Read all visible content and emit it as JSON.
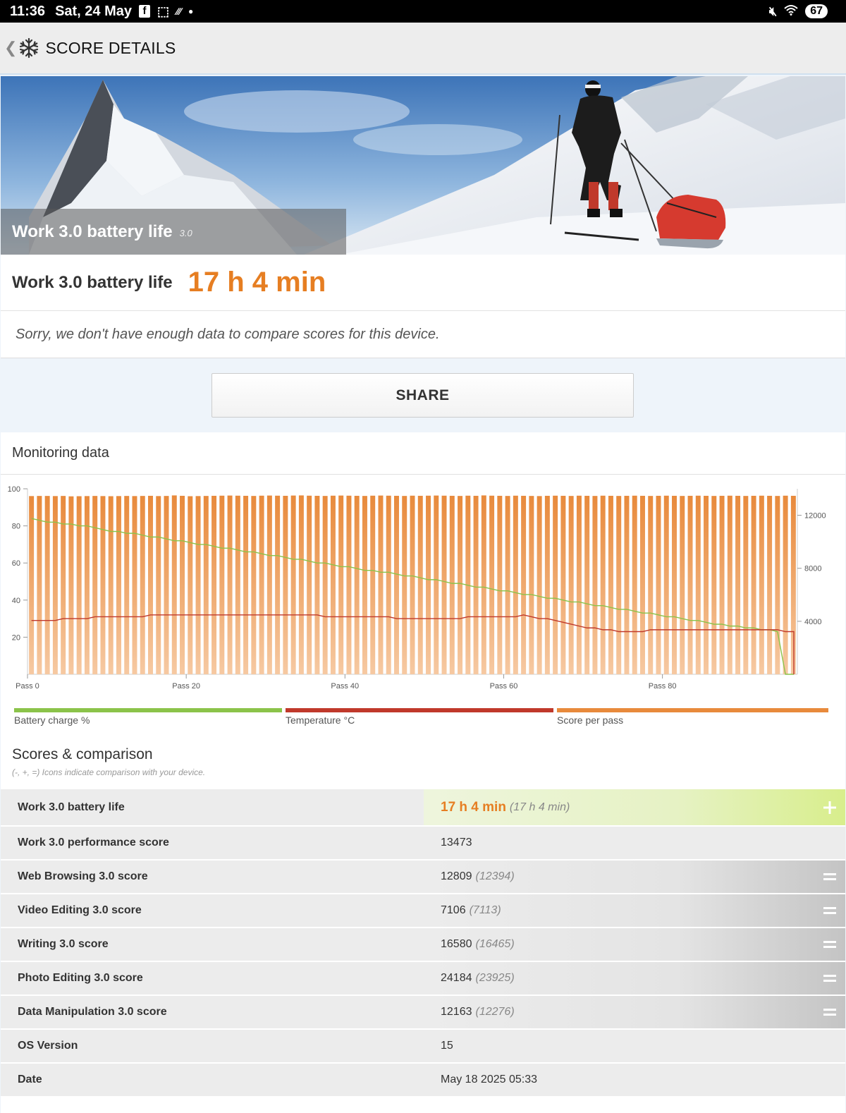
{
  "status_bar": {
    "time": "11:36",
    "date": "Sat, 24 May",
    "battery": "67"
  },
  "header": {
    "title": "SCORE DETAILS"
  },
  "hero": {
    "title": "Work 3.0 battery life",
    "version": "3.0"
  },
  "result": {
    "label": "Work 3.0 battery life",
    "value": "17 h 4 min",
    "note": "Sorry, we don't have enough data to compare scores for this device."
  },
  "share_label": "SHARE",
  "monitoring": {
    "title": "Monitoring data"
  },
  "chart_data": {
    "type": "bar",
    "x_tick_labels": [
      "Pass 0",
      "Pass 20",
      "Pass 40",
      "Pass 60",
      "Pass 80"
    ],
    "x_ticks": [
      0,
      20,
      40,
      60,
      80
    ],
    "xlim": [
      0,
      97
    ],
    "ylim_left": [
      0,
      100
    ],
    "left_ticks": [
      20,
      40,
      60,
      80,
      100
    ],
    "ylim_right": [
      0,
      14000
    ],
    "right_ticks": [
      4000,
      8000,
      12000
    ],
    "legend": [
      "Battery charge %",
      "Temperature °C",
      "Score per pass"
    ],
    "colors": {
      "battery": "#8bc34a",
      "temperature": "#c0392b",
      "score": "#e88a3c"
    },
    "series": [
      {
        "name": "Score per pass",
        "axis": "right",
        "values": [
          13450,
          13460,
          13460,
          13450,
          13460,
          13430,
          13440,
          13450,
          13460,
          13450,
          13440,
          13450,
          13460,
          13450,
          13460,
          13470,
          13450,
          13460,
          13500,
          13470,
          13440,
          13450,
          13460,
          13470,
          13480,
          13490,
          13480,
          13470,
          13460,
          13480,
          13490,
          13480,
          13470,
          13490,
          13500,
          13480,
          13470,
          13460,
          13480,
          13490,
          13480,
          13470,
          13460,
          13480,
          13490,
          13480,
          13470,
          13460,
          13480,
          13470,
          13480,
          13490,
          13480,
          13470,
          13460,
          13480,
          13470,
          13500,
          13480,
          13470,
          13460,
          13480,
          13470,
          13460,
          13450,
          13470,
          13480,
          13470,
          13460,
          13480,
          13470,
          13460,
          13480,
          13470,
          13460,
          13470,
          13480,
          13470,
          13460,
          13470,
          13480,
          13470,
          13460,
          13470,
          13480,
          13470,
          13460,
          13470,
          13480,
          13470,
          13460,
          13470,
          13480,
          13470,
          13460,
          13480,
          13470,
          13490
        ]
      },
      {
        "name": "Battery charge %",
        "axis": "left",
        "values": [
          84,
          83,
          82,
          82,
          81,
          81,
          80,
          80,
          79,
          78,
          77,
          77,
          76,
          76,
          75,
          74,
          74,
          73,
          72,
          72,
          71,
          70,
          70,
          69,
          68,
          68,
          67,
          66,
          66,
          65,
          64,
          64,
          63,
          62,
          62,
          61,
          60,
          60,
          59,
          58,
          58,
          57,
          56,
          56,
          55,
          55,
          54,
          53,
          53,
          52,
          51,
          51,
          50,
          49,
          49,
          48,
          47,
          47,
          46,
          45,
          45,
          44,
          43,
          43,
          42,
          41,
          41,
          40,
          39,
          39,
          38,
          37,
          37,
          36,
          35,
          35,
          34,
          33,
          33,
          32,
          31,
          31,
          30,
          29,
          29,
          28,
          27,
          27,
          26,
          26,
          25,
          25,
          24,
          24,
          23,
          0,
          0,
          0,
          0,
          0
        ]
      },
      {
        "name": "Temperature °C",
        "axis": "left",
        "values": [
          29,
          29,
          29,
          29,
          30,
          30,
          30,
          30,
          31,
          31,
          31,
          31,
          31,
          31,
          31,
          32,
          32,
          32,
          32,
          32,
          32,
          32,
          32,
          32,
          32,
          32,
          32,
          32,
          32,
          32,
          32,
          32,
          32,
          32,
          32,
          32,
          32,
          31,
          31,
          31,
          31,
          31,
          31,
          31,
          31,
          31,
          30,
          30,
          30,
          30,
          30,
          30,
          30,
          30,
          30,
          31,
          31,
          31,
          31,
          31,
          31,
          31,
          32,
          31,
          30,
          30,
          29,
          28,
          27,
          26,
          25,
          25,
          24,
          24,
          23,
          23,
          23,
          23,
          24,
          24,
          24,
          24,
          24,
          24,
          24,
          24,
          24,
          24,
          24,
          24,
          24,
          24,
          24,
          24,
          24,
          23,
          23,
          23,
          23,
          23,
          0,
          0,
          0,
          0,
          0
        ]
      }
    ]
  },
  "scores": {
    "title": "Scores & comparison",
    "note": "(-, +, =) Icons indicate comparison with your device.",
    "rows": [
      {
        "label": "Work 3.0 battery life",
        "value": "17 h 4 min",
        "ref": "(17 h 4 min)",
        "icon": "plus-icon"
      },
      {
        "label": "Work 3.0 performance score",
        "value": "13473",
        "ref": "",
        "icon": ""
      },
      {
        "label": "Web Browsing 3.0 score",
        "value": "12809",
        "ref": "(12394)",
        "icon": "equals-icon"
      },
      {
        "label": "Video Editing 3.0 score",
        "value": "7106",
        "ref": "(7113)",
        "icon": "equals-icon"
      },
      {
        "label": "Writing 3.0 score",
        "value": "16580",
        "ref": "(16465)",
        "icon": "equals-icon"
      },
      {
        "label": "Photo Editing 3.0 score",
        "value": "24184",
        "ref": "(23925)",
        "icon": "equals-icon"
      },
      {
        "label": "Data Manipulation 3.0 score",
        "value": "12163",
        "ref": "(12276)",
        "icon": "equals-icon"
      },
      {
        "label": "OS Version",
        "value": "15",
        "ref": "",
        "icon": ""
      },
      {
        "label": "Date",
        "value": "May 18 2025 05:33",
        "ref": "",
        "icon": ""
      }
    ]
  }
}
